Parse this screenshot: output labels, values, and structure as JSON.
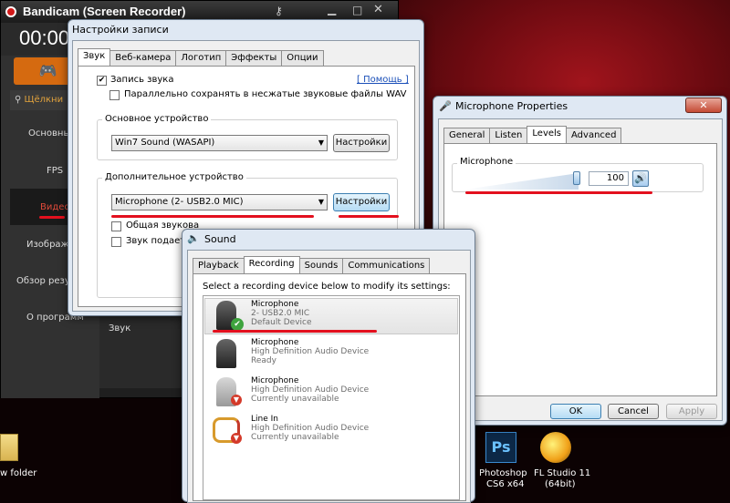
{
  "desktop": {
    "icons": [
      {
        "name": "photoshop",
        "label1": "Photoshop",
        "label2": "CS6 x64",
        "glyph": "Ps"
      },
      {
        "name": "flstudio",
        "label1": "FL Studio 11",
        "label2": "(64bit)"
      }
    ],
    "folder_label": "w folder"
  },
  "bandicam": {
    "title": "Bandicam (Screen Recorder)",
    "timer": "00:00",
    "search": "Щёлкни",
    "menu": [
      "Основные",
      "FPS",
      "Видео",
      "Изображе",
      "Обзор резул",
      "О программ"
    ],
    "sound_label": "Звук"
  },
  "record_settings": {
    "title": "Настройки записи",
    "tabs": [
      "Звук",
      "Веб-камера",
      "Логотип",
      "Эффекты",
      "Опции"
    ],
    "record_sound": "Запись звука",
    "parallel_save": "Параллельно сохранять в несжатые звуковые файлы WAV",
    "help": "[ Помощь ]",
    "main_device_group": "Основное устройство",
    "main_device": "Win7 Sound (WASAPI)",
    "settings_btn": "Настройки",
    "extra_device_group": "Дополнительное устройство",
    "extra_device": "Microphone (2- USB2.0 MIC)",
    "settings_btn2": "Настройки",
    "shared": "Общая звукова",
    "sound_two": "Звук подается"
  },
  "sound": {
    "title": "Sound",
    "tabs": [
      "Playback",
      "Recording",
      "Sounds",
      "Communications"
    ],
    "instruction": "Select a recording device below to modify its settings:",
    "devices": [
      {
        "name": "Microphone",
        "desc": "2- USB2.0 MIC",
        "status": "Default Device"
      },
      {
        "name": "Microphone",
        "desc": "High Definition Audio Device",
        "status": "Ready"
      },
      {
        "name": "Microphone",
        "desc": "High Definition Audio Device",
        "status": "Currently unavailable"
      },
      {
        "name": "Line In",
        "desc": "High Definition Audio Device",
        "status": "Currently unavailable"
      }
    ]
  },
  "mic_props": {
    "title": "Microphone Properties",
    "tabs": [
      "General",
      "Listen",
      "Levels",
      "Advanced"
    ],
    "level_label": "Microphone",
    "level_value": "100",
    "level_fraction": 1.0,
    "ok": "OK",
    "cancel": "Cancel",
    "apply": "Apply"
  }
}
